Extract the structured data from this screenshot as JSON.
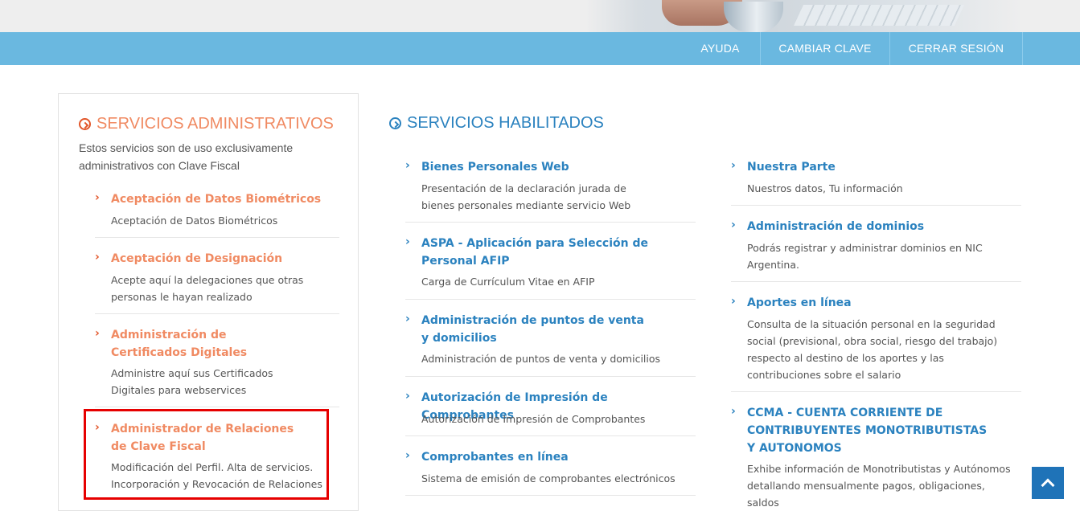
{
  "nav": {
    "items": [
      {
        "label": "AYUDA"
      },
      {
        "label": "CAMBIAR CLAVE"
      },
      {
        "label": "CERRAR SESIÓN"
      }
    ]
  },
  "admin": {
    "title": "SERVICIOS ADMINISTRATIVOS",
    "intro": "Estos servicios son de uso exclusivamente administrativos con Clave Fiscal",
    "services": [
      {
        "title": "Aceptación de Datos Biométricos",
        "desc": "Aceptación de Datos Biométricos"
      },
      {
        "title": "Aceptación de Designación",
        "desc": "Acepte aquí la delegaciones que otras personas le hayan realizado"
      },
      {
        "title": "Administración de Certificados Digitales",
        "desc": "Administre aquí sus Certificados Digitales para webservices"
      },
      {
        "title": "Administrador de Relaciones de Clave Fiscal",
        "desc": "Modificación del Perfil. Alta de servicios. Incorporación y Revocación de Relaciones"
      }
    ]
  },
  "enabled": {
    "title": "SERVICIOS HABILITADOS",
    "col1": [
      {
        "title": "Bienes Personales Web",
        "desc": "Presentación de la declaración jurada de bienes personales mediante servicio Web"
      },
      {
        "title": "ASPA - Aplicación para Selección de Personal AFIP",
        "desc": "Carga de Currículum Vitae en AFIP"
      },
      {
        "title": "Administración de puntos de venta y domicilios",
        "desc": "Administración de puntos de venta y domicilios"
      },
      {
        "title": "Autorización de Impresión de Comprobantes",
        "desc": "Autorización de Impresión de Comprobantes"
      },
      {
        "title": "Comprobantes en línea",
        "desc": "Sistema de emisión de comprobantes electrónicos"
      }
    ],
    "col2": [
      {
        "title": "Nuestra Parte",
        "desc": "Nuestros datos, Tu información"
      },
      {
        "title": "Administración de dominios",
        "desc": "Podrás registrar y administrar dominios en NIC Argentina."
      },
      {
        "title": "Aportes en línea",
        "desc": "Consulta de la situación personal en la seguridad social (previsional, obra social, riesgo del trabajo) respecto al destino de los aportes y las contribuciones sobre el salario"
      },
      {
        "title": "CCMA - CUENTA CORRIENTE DE CONTRIBUYENTES MONOTRIBUTISTAS Y AUTONOMOS",
        "desc": "Exhibe información de Monotributistas y Autónomos detallando mensualmente pagos, obligaciones, saldos"
      }
    ]
  },
  "colors": {
    "nav": "#6ab8e0",
    "admin_accent": "#f08a62",
    "enabled_accent": "#2b82bf",
    "highlight": "#e60000",
    "scroll_button": "#1f73b8"
  },
  "icons": {
    "section_bullet": "circle-chevron-right-icon",
    "item_bullet": "chevron-right-icon",
    "scroll_top": "chevron-up-icon"
  }
}
